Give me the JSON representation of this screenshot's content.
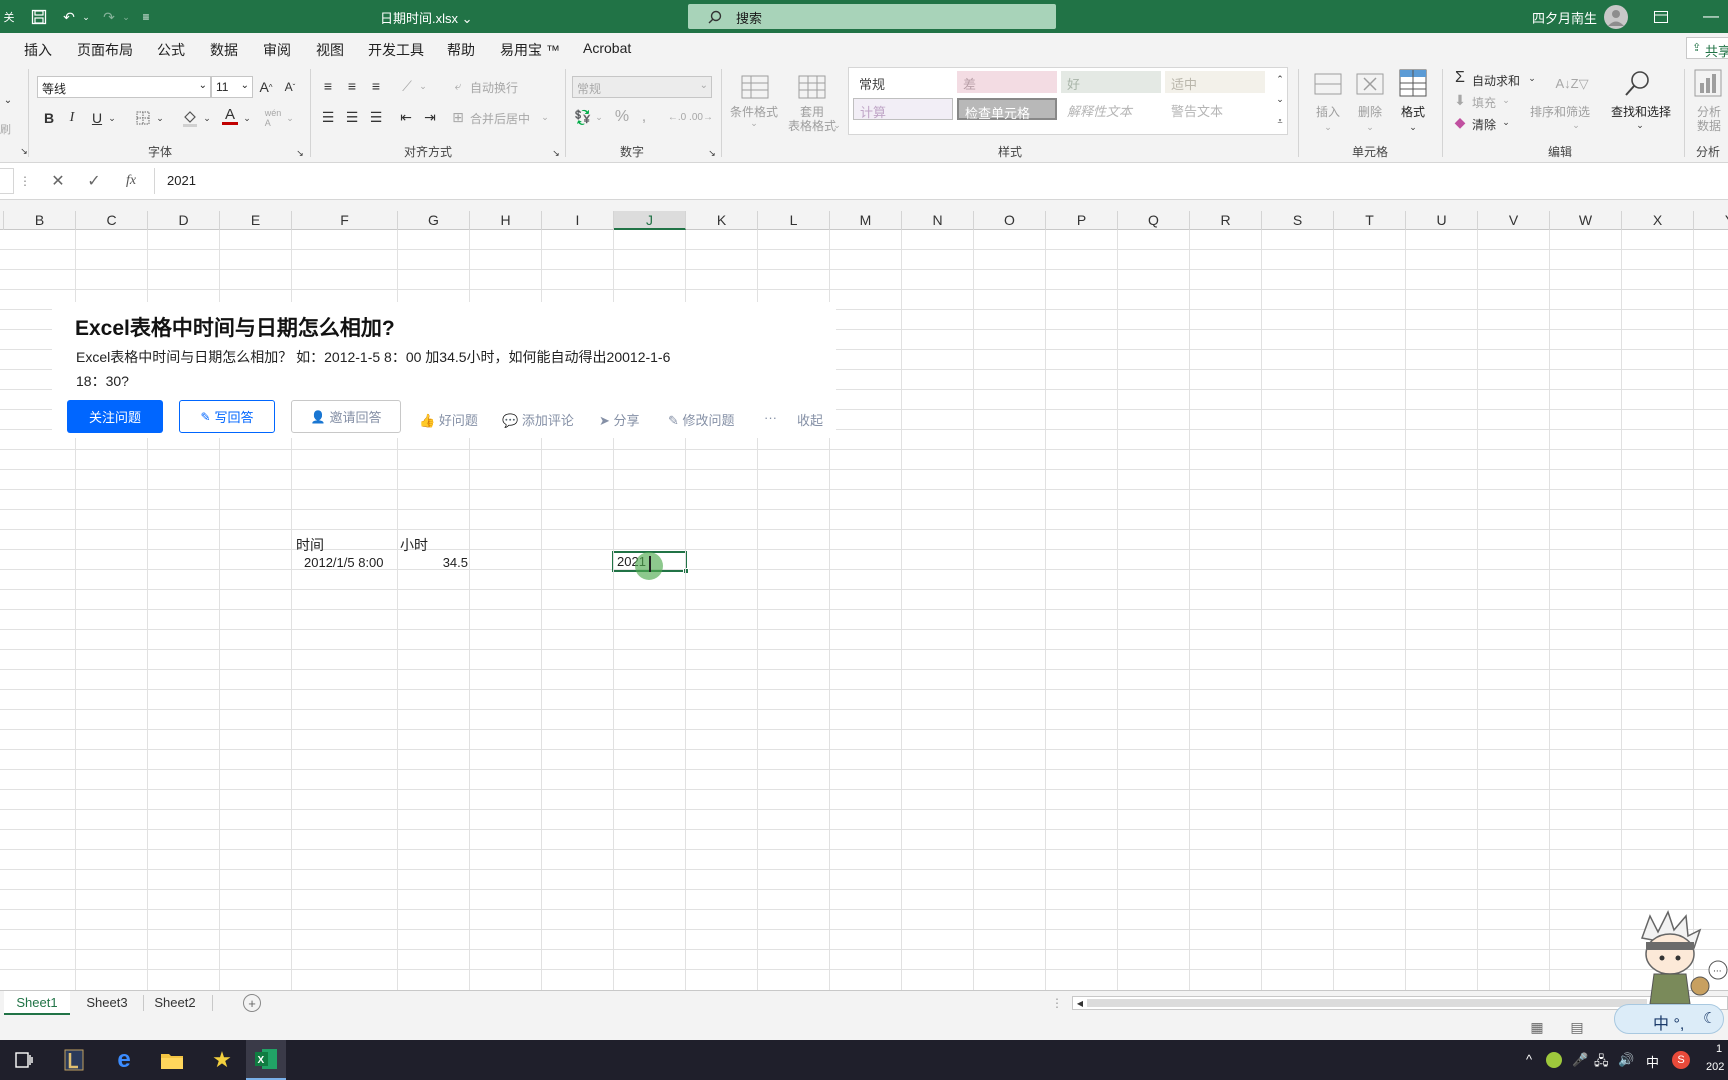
{
  "titlebar": {
    "doc_title": "日期时间.xlsx ⌄",
    "search_label": "搜索",
    "user_name": "四夕月南生",
    "autosave_label": "关"
  },
  "ribbon_tabs": [
    "插入",
    "页面布局",
    "公式",
    "数据",
    "审阅",
    "视图",
    "开发工具",
    "帮助",
    "易用宝 ™",
    "Acrobat"
  ],
  "share_label": "共享",
  "font_group": {
    "font_name": "等线",
    "font_size": "11",
    "label": "字体"
  },
  "align_group": {
    "wrap_label": "自动换行",
    "merge_label": "合并后居中",
    "label": "对齐方式"
  },
  "number_group": {
    "format": "常规",
    "label": "数字"
  },
  "styles_group": {
    "conditional_label": "条件格式",
    "table_label_1": "套用",
    "table_label_2": "表格格式",
    "cells": [
      "常规",
      "差",
      "好",
      "适中",
      "计算",
      "检查单元格",
      "解释性文本",
      "警告文本"
    ],
    "label": "样式"
  },
  "cells_group": {
    "insert_label": "插入",
    "delete_label": "删除",
    "format_label": "格式",
    "label": "单元格"
  },
  "edit_group": {
    "autosum_label": "自动求和",
    "fill_label": "填充",
    "clear_label": "清除",
    "sort_label": "排序和筛选",
    "find_label": "查找和选择",
    "label": "编辑"
  },
  "analysis_group": {
    "btn_label_1": "分析",
    "btn_label_2": "数据",
    "label": "分析"
  },
  "formula_bar": {
    "value": "2021",
    "fx": "fx"
  },
  "columns": [
    "B",
    "C",
    "D",
    "E",
    "F",
    "G",
    "H",
    "I",
    "J",
    "K",
    "L",
    "M",
    "N",
    "O",
    "P",
    "Q",
    "R",
    "S",
    "T",
    "U",
    "V",
    "W",
    "X",
    "Y"
  ],
  "selected_column": "J",
  "cells": {
    "f_header": "时间",
    "g_header": "小时",
    "f_value": "2012/1/5 8:00",
    "g_value": "34.5",
    "j_value": "2021"
  },
  "question_card": {
    "title": "Excel表格中时间与日期怎么相加?",
    "desc_line1": "Excel表格中时间与日期怎么相加？ 如：2012-1-5 8：00 加34.5小时，如何能自动得出20012-1-6",
    "desc_line2": "18：30?",
    "follow_label": "关注问题",
    "answer_label": "写回答",
    "invite_label": "邀请回答",
    "good_label": "好问题",
    "comment_label": "添加评论",
    "share_label": "分享",
    "edit_label": "修改问题",
    "more_label": "···",
    "collapse_label": "收起"
  },
  "sheets": [
    "Sheet1",
    "Sheet3",
    "Sheet2"
  ],
  "active_sheet": "Sheet1",
  "ime_label": "中 °,",
  "taskbar": {
    "tray_ime": "中",
    "clock_time": "1",
    "clock_date": "202"
  },
  "colors": {
    "excel_green": "#217346",
    "zhihu_blue": "#0066ff"
  }
}
